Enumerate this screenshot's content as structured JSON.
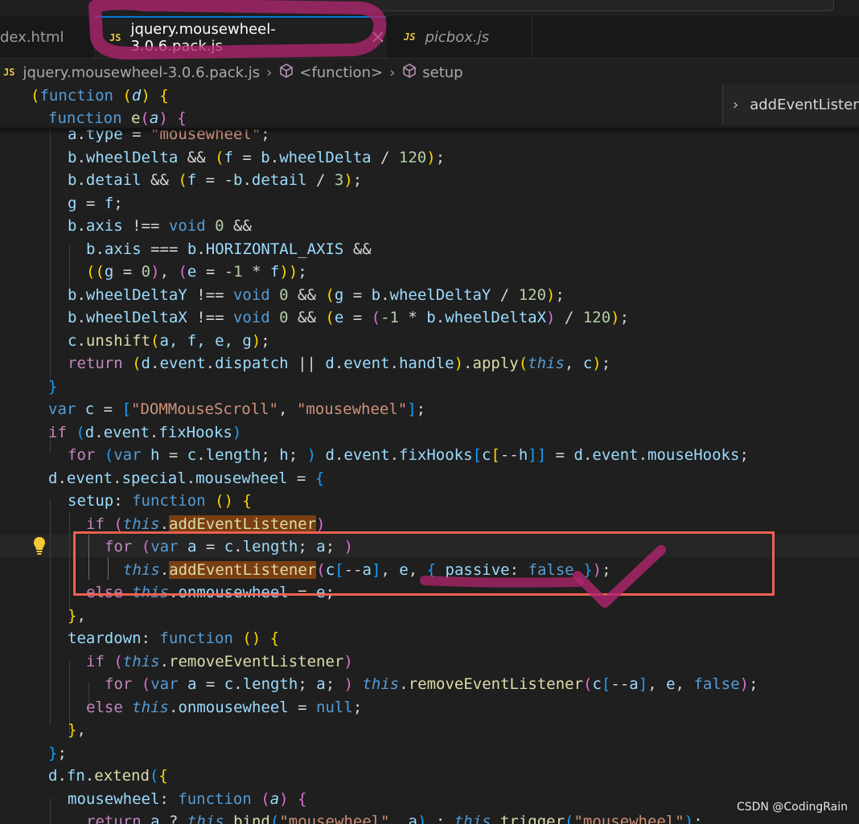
{
  "tabs": [
    {
      "label": "dex.html",
      "icon": "html-file-icon",
      "active": false
    },
    {
      "label": "jquery.mousewheel-3.0.6.pack.js",
      "icon": "js-file-icon",
      "active": true,
      "close": "✕"
    },
    {
      "label": "picbox.js",
      "icon": "js-file-icon",
      "active": false
    }
  ],
  "js_badge": "JS",
  "breadcrumb": {
    "file": "jquery.mousewheel-3.0.6.pack.js",
    "items": [
      "<function>",
      "setup"
    ],
    "separator": "›"
  },
  "outline": {
    "label": "addEventListen"
  },
  "watermark": "CSDN @CodingRain",
  "annotation_colors": {
    "marker": "#b0256e",
    "box": "#f0614f",
    "highlight": "#7a3e12"
  },
  "code": {
    "sticky1": {
      "p1": "(",
      "kw": "function",
      "p2": " (",
      "arg": "d",
      "p3": ") {"
    },
    "sticky2": {
      "kw": "function",
      "fn": " e",
      "p1": "(",
      "arg": "a",
      "p2": ") {"
    },
    "l0": {
      "v": "a",
      "d": ".",
      "prop": "type",
      "op": " = ",
      "st": "\"mousewheel\"",
      "end": ";"
    },
    "l1": {
      "v": "b",
      "d": ".",
      "prop": "wheelDelta",
      "op": " && ",
      "b": "(",
      "v2": "f",
      "op2": " = ",
      "v3": "b",
      "d2": ".",
      "prop2": "wheelDelta",
      "op3": " / ",
      "nm": "120",
      "b2": ")",
      "end": ";"
    },
    "l2": {
      "v": "b",
      "d": ".",
      "prop": "detail",
      "op": " && ",
      "b": "(",
      "v2": "f",
      "op2": " = -",
      "v3": "b",
      "d2": ".",
      "prop2": "detail",
      "op3": " / ",
      "nm": "3",
      "b2": ")",
      "end": ";"
    },
    "l3": {
      "v": "g",
      "op": " = ",
      "v2": "f",
      "end": ";"
    },
    "l4": {
      "v": "b",
      "d": ".",
      "prop": "axis",
      "op": " !== ",
      "kw": "void",
      "nm": " 0",
      "op2": " &&"
    },
    "l5": {
      "v": "b",
      "d": ".",
      "prop": "axis",
      "op": " === ",
      "v2": "b",
      "d2": ".",
      "prop2": "HORIZONTAL_AXIS",
      "op2": " &&"
    },
    "l6": {
      "b": "((",
      "v": "g",
      "op": " = ",
      "nm": "0",
      "b2": ")",
      "sep": ", ",
      "b3": "(",
      "v2": "e",
      "op2": " = -",
      "nm2": "1",
      "op3": " * ",
      "v3": "f",
      "b4": "))",
      "end": ";"
    },
    "l7": {
      "v": "b",
      "d": ".",
      "prop": "wheelDeltaY",
      "op": " !== ",
      "kw": "void",
      "nm": " 0",
      "op2": " && ",
      "b": "(",
      "v2": "g",
      "op3": " = ",
      "v3": "b",
      "d2": ".",
      "prop2": "wheelDeltaY",
      "op4": " / ",
      "nm2": "120",
      "b2": ")",
      "end": ";"
    },
    "l8": {
      "v": "b",
      "d": ".",
      "prop": "wheelDeltaX",
      "op": " !== ",
      "kw": "void",
      "nm": " 0",
      "op2": " && ",
      "b": "(",
      "v2": "e",
      "op3": " = ",
      "b3": "(",
      "nm2": "-1",
      "op4": " * ",
      "v3": "b",
      "d2": ".",
      "prop2": "wheelDeltaX",
      "b4": ")",
      "op5": " / ",
      "nm3": "120",
      "b2": ")",
      "end": ";"
    },
    "l9": {
      "v": "c",
      "d": ".",
      "fn": "unshift",
      "b": "(",
      "args": "a, f, e, g",
      "b2": ")",
      "end": ";"
    },
    "l10": {
      "ct": "return",
      "sp": " ",
      "b": "(",
      "v": "d",
      "d": ".",
      "prop": "event",
      "d2": ".",
      "prop2": "dispatch",
      "op": " || ",
      "v2": "d",
      "d3": ".",
      "prop3": "event",
      "d4": ".",
      "prop4": "handle",
      "b2": ")",
      "d5": ".",
      "fn": "apply",
      "b3": "(",
      "th": "this",
      "sep": ", ",
      "v3": "c",
      "b4": ")",
      "end": ";"
    },
    "l11": {
      "b": "}"
    },
    "l12": {
      "kw": "var",
      "sp": " ",
      "v": "c",
      "op": " = ",
      "b": "[",
      "st": "\"DOMMouseScroll\"",
      "sep": ", ",
      "st2": "\"mousewheel\"",
      "b2": "]",
      "end": ";"
    },
    "l13": {
      "ct": "if",
      "sp": " ",
      "b": "(",
      "v": "d",
      "d": ".",
      "prop": "event",
      "d2": ".",
      "prop2": "fixHooks",
      "b2": ")"
    },
    "l14": {
      "ct": "for",
      "sp": " ",
      "b": "(",
      "kw": "var",
      "sp2": " ",
      "v": "h",
      "op": " = ",
      "v2": "c",
      "d": ".",
      "prop": "length",
      "sep": "; ",
      "v3": "h",
      "sep2": "; ",
      "b2": ")",
      "sp3": " ",
      "v4": "d",
      "d2": ".",
      "prop2": "event",
      "d3": ".",
      "prop3": "fixHooks",
      "b3": "[",
      "v5": "c",
      "b4": "[",
      "op2": "--",
      "v6": "h",
      "b5": "]]",
      "op3": " = ",
      "v7": "d",
      "d4": ".",
      "prop4": "event",
      "d5": ".",
      "prop5": "mouseHooks",
      "end": ";"
    },
    "l15": {
      "v": "d",
      "d": ".",
      "prop": "event",
      "d2": ".",
      "prop2": "special",
      "d3": ".",
      "prop3": "mousewheel",
      "op": " = ",
      "b": "{"
    },
    "l16": {
      "prop": "setup",
      "op": ": ",
      "kw": "function",
      "sp": " ",
      "b": "()",
      "sp2": " ",
      "b2": "{"
    },
    "l17": {
      "ct": "if",
      "sp": " ",
      "b": "(",
      "th": "this",
      "d": ".",
      "fn": "addEventListener",
      "b2": ")"
    },
    "l18": {
      "ct": "for",
      "sp": " ",
      "b": "(",
      "kw": "var",
      "sp2": " ",
      "v": "a",
      "op": " = ",
      "v2": "c",
      "d": ".",
      "prop": "length",
      "sep": "; ",
      "v3": "a",
      "sep2": "; ",
      "b2": ")"
    },
    "l19": {
      "th": "this",
      "d": ".",
      "fn": "addEventListener",
      "b": "(",
      "v": "c",
      "b2": "[",
      "op": "--",
      "v2": "a",
      "b3": "]",
      "sep": ", ",
      "v3": "e",
      "sep2": ", ",
      "b4": "{",
      "sp": " ",
      "prop": "passive",
      "op2": ": ",
      "kw": "false",
      "sp2": " ",
      "b5": "}",
      "b6": ")",
      "end": ";"
    },
    "l20": {
      "ct": "else",
      "sp": " ",
      "th": "this",
      "d": ".",
      "prop": "onmousewheel",
      "op": " = ",
      "v": "e",
      "end": ";"
    },
    "l21": {
      "b": "}",
      "end": ","
    },
    "l22": {
      "prop": "teardown",
      "op": ": ",
      "kw": "function",
      "sp": " ",
      "b": "()",
      "sp2": " ",
      "b2": "{"
    },
    "l23": {
      "ct": "if",
      "sp": " ",
      "b": "(",
      "th": "this",
      "d": ".",
      "fn": "removeEventListener",
      "b2": ")"
    },
    "l24": {
      "ct": "for",
      "sp": " ",
      "b": "(",
      "kw": "var",
      "sp2": " ",
      "v": "a",
      "op": " = ",
      "v2": "c",
      "d": ".",
      "prop": "length",
      "sep": "; ",
      "v3": "a",
      "sep2": "; ",
      "b2": ")",
      "sp3": " ",
      "th": "this",
      "d2": ".",
      "fn": "removeEventListener",
      "b3": "(",
      "v4": "c",
      "b4": "[",
      "op2": "--",
      "v5": "a",
      "b5": "]",
      "sep3": ", ",
      "v6": "e",
      "sep4": ", ",
      "kw2": "false",
      "b6": ")",
      "end": ";"
    },
    "l25": {
      "ct": "else",
      "sp": " ",
      "th": "this",
      "d": ".",
      "prop": "onmousewheel",
      "op": " = ",
      "kw": "null",
      "end": ";"
    },
    "l26": {
      "b": "}",
      "end": ","
    },
    "l27": {
      "b": "}",
      "end": ";"
    },
    "l28": {
      "v": "d",
      "d": ".",
      "prop": "fn",
      "d2": ".",
      "fn": "extend",
      "b": "(",
      "b2": "{"
    },
    "l29": {
      "prop": "mousewheel",
      "op": ": ",
      "kw": "function",
      "sp": " ",
      "b": "(",
      "arg": "a",
      "b2": ")",
      "sp2": " ",
      "b3": "{"
    },
    "l30": {
      "ct": "return",
      "sp": " ",
      "v": "a",
      "op": " ? ",
      "th": "this",
      "d": ".",
      "fn": "bind",
      "b": "(",
      "st": "\"mousewheel\"",
      "sep": ", ",
      "v2": "a",
      "b2": ")",
      "op2": " : ",
      "th2": "this",
      "d2": ".",
      "fn2": "trigger",
      "b3": "(",
      "st2": "\"mousewheel\"",
      "b4": ")",
      "end": ";"
    }
  }
}
